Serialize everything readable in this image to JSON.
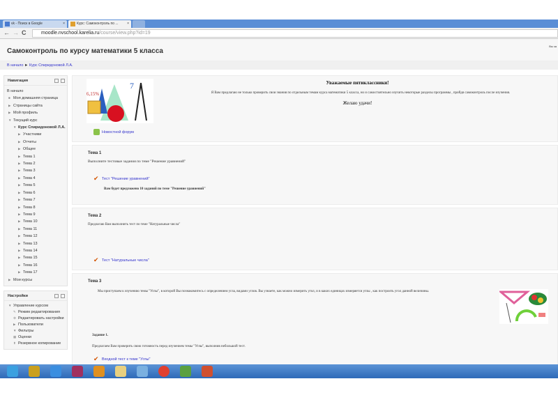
{
  "browser": {
    "tabs": [
      {
        "label": "vk - Поиск в Google"
      },
      {
        "label": "Курс: Самоконтроль по ..."
      }
    ],
    "close_glyph": "×",
    "url_host": "moodle.nvschool.karelia.ru",
    "url_path": "/course/view.php?id=19"
  },
  "header": {
    "title": "Самоконтроль по курсу математики 5 класса",
    "login": "Вы за"
  },
  "breadcrumb": {
    "home": "В начало",
    "separator": "►",
    "course": "Курс Спиридоновой Л.А."
  },
  "navigation": {
    "title": "Навигация",
    "home": "В начало",
    "items": [
      {
        "label": "Моя домашняя страница",
        "level": 1,
        "link": true
      },
      {
        "label": "Страницы сайта",
        "level": 1
      },
      {
        "label": "Мой профиль",
        "level": 1
      },
      {
        "label": "Текущий курс",
        "level": 1
      },
      {
        "label": "Курс Спиридоновой Л.А.",
        "level": 2,
        "link": true,
        "bold": true
      },
      {
        "label": "Участники",
        "level": 3,
        "link": true
      },
      {
        "label": "Отчеты",
        "level": 3
      },
      {
        "label": "Общее",
        "level": 3
      },
      {
        "label": "Тема 1",
        "level": 3
      },
      {
        "label": "Тема 2",
        "level": 3
      },
      {
        "label": "Тема 3",
        "level": 3
      },
      {
        "label": "Тема 4",
        "level": 3
      },
      {
        "label": "Тема 5",
        "level": 3
      },
      {
        "label": "Тема 6",
        "level": 3
      },
      {
        "label": "Тема 7",
        "level": 3
      },
      {
        "label": "Тема 8",
        "level": 3
      },
      {
        "label": "Тема 9",
        "level": 3
      },
      {
        "label": "Тема 10",
        "level": 3
      },
      {
        "label": "Тема 11",
        "level": 3
      },
      {
        "label": "Тема 12",
        "level": 3
      },
      {
        "label": "Тема 13",
        "level": 3
      },
      {
        "label": "Тема 14",
        "level": 3
      },
      {
        "label": "Тема 15",
        "level": 3
      },
      {
        "label": "Тема 16",
        "level": 3
      },
      {
        "label": "Тема 17",
        "level": 3
      },
      {
        "label": "Мои курсы",
        "level": 1,
        "link": true
      }
    ]
  },
  "settings": {
    "title": "Настройки",
    "items": [
      {
        "label": "Управление курсом",
        "icon": "arrow"
      },
      {
        "label": "Режим редактирования",
        "icon": "pencil",
        "link": true
      },
      {
        "label": "Редактировать настройки",
        "icon": "gear",
        "link": true
      },
      {
        "label": "Пользователи",
        "icon": "arrow"
      },
      {
        "label": "Фильтры",
        "icon": "filter",
        "link": true
      },
      {
        "label": "Оценки",
        "icon": "grades",
        "link": true
      },
      {
        "label": "Резервное копирование",
        "icon": "backup",
        "link": true
      }
    ]
  },
  "intro": {
    "greeting": "Уважаемые пятиклассники!",
    "text": "Я Вам предлагаю не только проверить свои знания по  отдельным темам курса математики 5 класса, но и   самостоятельно изучить некоторые разделы программы , пройдя самоконтроль после изучения.",
    "wish": "Желаю удачи!",
    "forum": "Новостной форум",
    "image_label": "6,15%"
  },
  "topics": [
    {
      "title": "Тема 1",
      "text": "Выполните тестовые задания по теме \"Решение уравнений\"",
      "activity": "Тест \"Решение уравнений\"",
      "note": "Вам будет предложено 10 заданий по теме \"Решение уравнений\""
    },
    {
      "title": "Тема 2",
      "text": "Предлагаю Вам выполнить тест по теме \"Натуральные числа\"",
      "activity": "Тест \"Натуральные числа\""
    },
    {
      "title": "Тема 3",
      "text": "Мы приступаем к изучению темы \"Углы\",  в которой Вы познакомитесь  с определением угла, видами углов. Вы узнаете, как можно измерить угол,  и в каких единицах измеряется углы , как построить угол данной величины.",
      "task": "Задание 1.",
      "task_text": "Предлагаем Вам проверить свою готовность  перед изучением темы \"Углы\", выполнив небольшой тест.",
      "activity": "Входной тест к теме \"Углы\""
    }
  ],
  "taskbar": {
    "icons": [
      "rocket",
      "media-player",
      "internet-explorer",
      "photo-app",
      "mail",
      "file-explorer",
      "volume",
      "chrome",
      "utorrent",
      "powerpoint"
    ]
  }
}
